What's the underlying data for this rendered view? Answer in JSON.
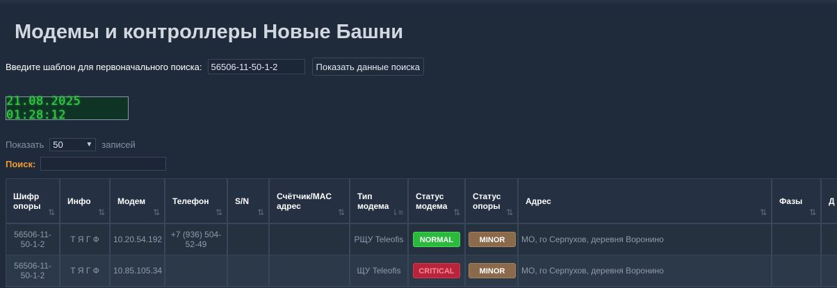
{
  "page": {
    "title": "Модемы и контроллеры Новые Башни"
  },
  "search": {
    "label": "Введите шаблон для первоначального поиска:",
    "value": "56506-11-50-1-2",
    "button_label": "Показать данные поиска"
  },
  "clock": {
    "datetime": "21.08.2025 01:28:12"
  },
  "length_menu": {
    "prefix": "Показать",
    "selected": "50",
    "suffix": "записей"
  },
  "filter": {
    "label": "Поиск:",
    "value": ""
  },
  "table": {
    "columns": [
      {
        "label": "Шифр\nопоры",
        "icon": "sort-icon"
      },
      {
        "label": "Инфо",
        "icon": "sort-icon"
      },
      {
        "label": "Модем",
        "icon": "sort-icon"
      },
      {
        "label": "Телефон",
        "icon": "sort-icon"
      },
      {
        "label": "S/N",
        "icon": "sort-icon"
      },
      {
        "label": "Счётчик/MAC\nадрес",
        "icon": "sort-icon"
      },
      {
        "label": "Тип\nмодема",
        "icon": "sort-active-icon"
      },
      {
        "label": "Статус\nмодема",
        "icon": "sort-icon"
      },
      {
        "label": "Статус\nопоры",
        "icon": "sort-icon"
      },
      {
        "label": "Адрес",
        "icon": "sort-icon"
      },
      {
        "label": "Фазы",
        "icon": "sort-icon"
      },
      {
        "label": "Д",
        "icon": ""
      }
    ],
    "sort_glyph": "⇅",
    "sort_active_glyph": "⇂≡",
    "rows": [
      {
        "code": "56506-11-50-1-2",
        "info": "Т Я Г Ф",
        "modem": "10.20.54.192",
        "phone": "+7 (936) 504-52-49",
        "sn": "",
        "meter": "",
        "type": "РЩУ Teleofis",
        "modem_status": "NORMAL",
        "tower_status": "MINOR",
        "address": "МО, го Серпухов, деревня Воронино",
        "phases": "",
        "extra": ""
      },
      {
        "code": "56506-11-50-1-2",
        "info": "Т Я Г Ф",
        "modem": "10.85.105.34",
        "phone": "",
        "sn": "",
        "meter": "",
        "type": "ЩУ Teleofis",
        "modem_status": "CRITICAL",
        "tower_status": "MINOR",
        "address": "МО, го Серпухов, деревня Воронино",
        "phases": "",
        "extra": ""
      }
    ]
  },
  "colors": {
    "background": "#1f2a3a",
    "clock_text": "#37d34a",
    "filter_label": "#f39c34",
    "status_normal": "#2bb93e",
    "status_critical": "#b8243a",
    "status_minor": "#8a6a4b"
  }
}
